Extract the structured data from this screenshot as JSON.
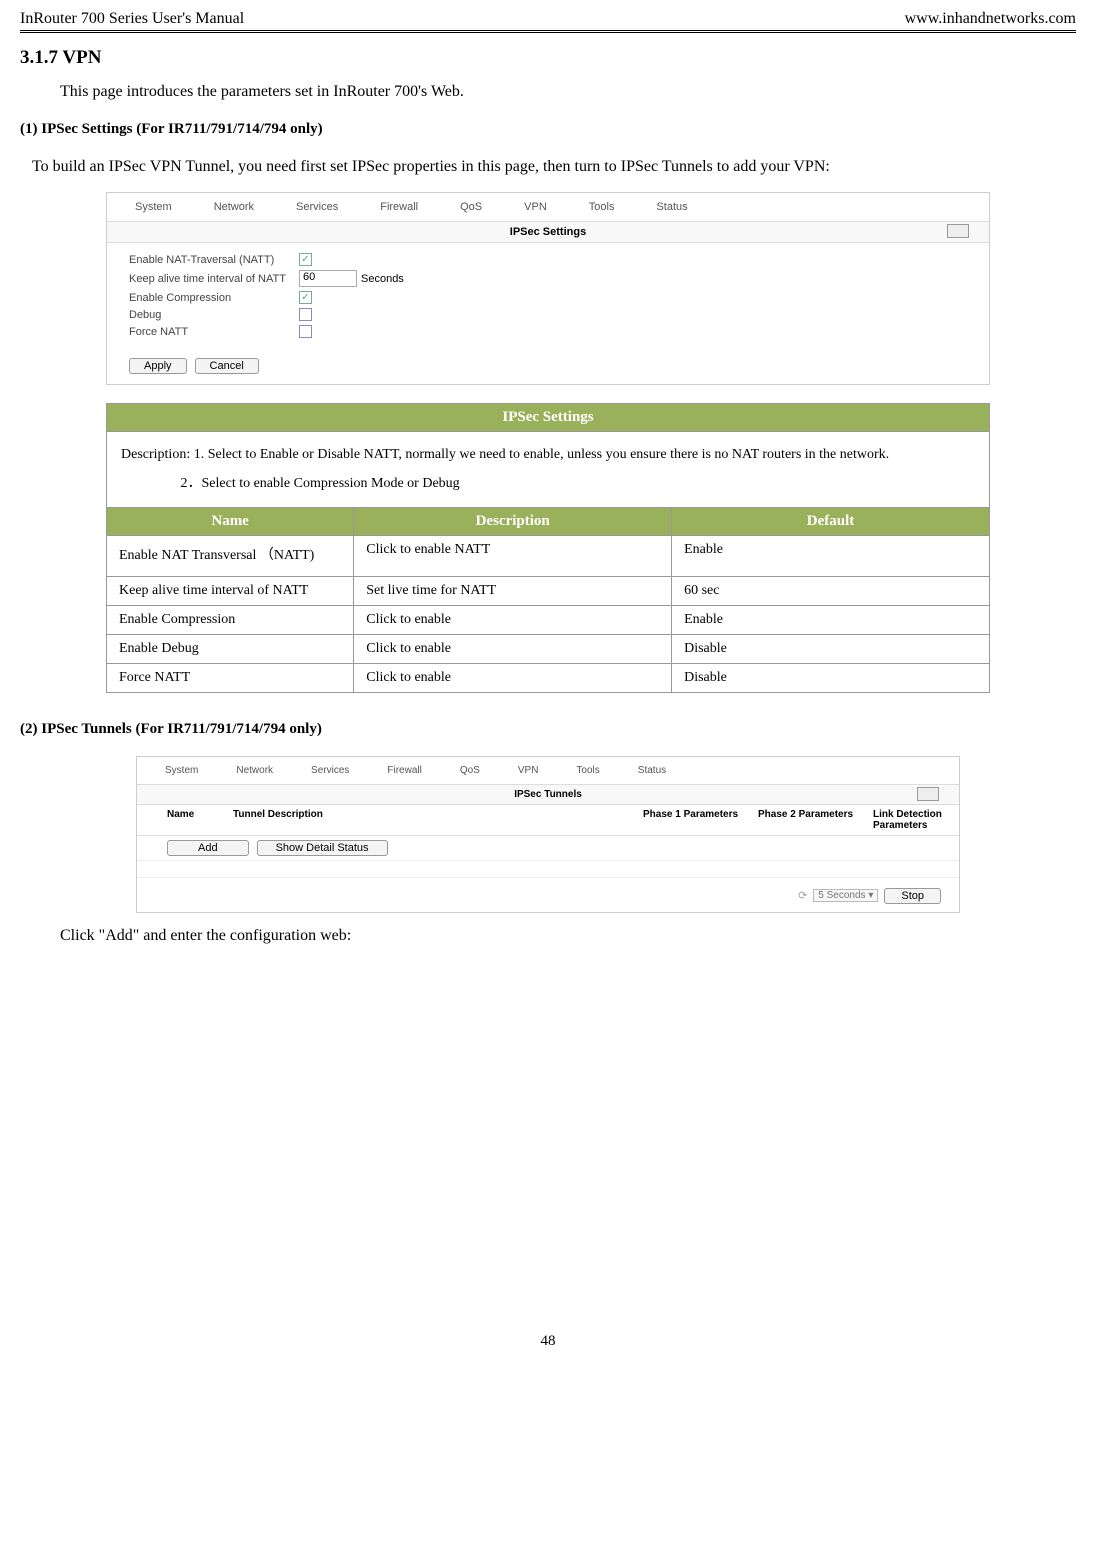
{
  "header": {
    "left": "InRouter 700 Series User's Manual",
    "right": "www.inhandnetworks.com"
  },
  "section": {
    "num": "3.1.7",
    "title": "VPN"
  },
  "intro": "This page introduces the parameters set in InRouter 700's Web.",
  "sub1": {
    "num": "(1)",
    "title": "IPSec Settings (For IR711/791/714/794 only)",
    "text": "To build an IPSec VPN Tunnel, you need first set IPSec properties in this page, then turn to IPSec Tunnels to add your VPN:"
  },
  "nav": [
    "System",
    "Network",
    "Services",
    "Firewall",
    "QoS",
    "VPN",
    "Tools",
    "Status"
  ],
  "panel1": {
    "title": "IPSec Settings",
    "rows": {
      "natt": "Enable NAT-Traversal (NATT)",
      "keepalive": "Keep alive time interval of NATT",
      "keepalive_val": "60",
      "keepalive_unit": "Seconds",
      "comp": "Enable Compression",
      "debug": "Debug",
      "force": "Force NATT"
    },
    "apply": "Apply",
    "cancel": "Cancel"
  },
  "table1": {
    "header": "IPSec Settings",
    "desc_label": "Description:",
    "desc1": "1. Select to Enable or Disable NATT, normally we need to enable, unless you ensure there is no NAT routers in the network.",
    "desc2": "2．Select to enable Compression Mode or Debug",
    "cols": {
      "name": "Name",
      "desc": "Description",
      "default": "Default"
    },
    "rows": [
      {
        "name": "Enable NAT Transversal （NATT)",
        "desc": "Click to enable NATT",
        "def": "Enable"
      },
      {
        "name": "Keep alive time interval of NATT",
        "desc": "Set live time for NATT",
        "def": "60 sec"
      },
      {
        "name": "Enable Compression",
        "desc": "Click to enable",
        "def": "Enable"
      },
      {
        "name": "Enable Debug",
        "desc": "Click to enable",
        "def": "Disable"
      },
      {
        "name": "Force NATT",
        "desc": "Click to enable",
        "def": "Disable"
      }
    ]
  },
  "sub2": {
    "num": "(2)",
    "title": "IPSec Tunnels (For IR711/791/714/794 only)"
  },
  "panel2": {
    "title": "IPSec Tunnels",
    "cols": {
      "name": "Name",
      "tdesc": "Tunnel Description",
      "p1": "Phase 1 Parameters",
      "p2": "Phase 2 Parameters",
      "ld": "Link Detection Parameters"
    },
    "add": "Add",
    "show": "Show Detail Status",
    "interval": "5 Seconds",
    "stop": "Stop"
  },
  "clicktext": "Click \"Add\" and enter the configuration web:",
  "pagenum": "48"
}
